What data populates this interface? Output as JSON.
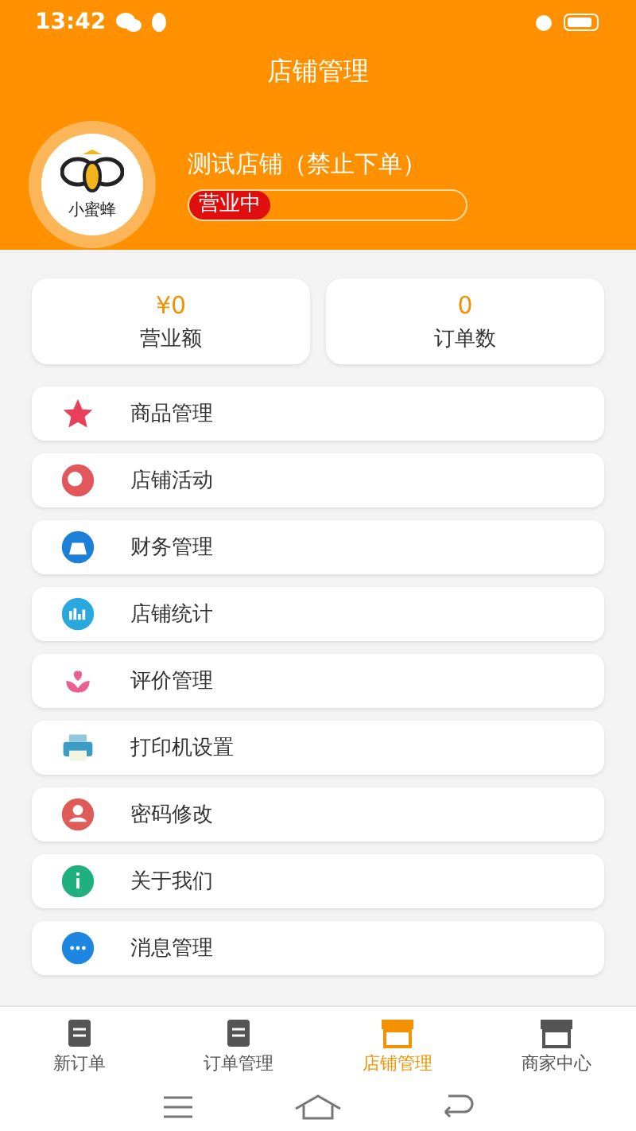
{
  "status_bar": {
    "time": "13:42"
  },
  "header": {
    "title": "店铺管理"
  },
  "shop": {
    "logo_text": "小蜜蜂",
    "name": "测试店铺（禁止下单）",
    "status": "营业中"
  },
  "stats": [
    {
      "value": "¥0",
      "label": "营业额"
    },
    {
      "value": "0",
      "label": "订单数"
    }
  ],
  "menu": [
    {
      "label": "商品管理",
      "kind": "star",
      "color": "#e8405a"
    },
    {
      "label": "店铺活动",
      "kind": "balloon",
      "color": "#e2575c"
    },
    {
      "label": "财务管理",
      "kind": "bag",
      "color": "#1c7fd8"
    },
    {
      "label": "店铺统计",
      "kind": "chart",
      "color": "#29a8e0"
    },
    {
      "label": "评价管理",
      "kind": "flower",
      "color": "#ea5f8f"
    },
    {
      "label": "打印机设置",
      "kind": "printer",
      "color": "#3b9cc4"
    },
    {
      "label": "密码修改",
      "kind": "user",
      "color": "#df5b55"
    },
    {
      "label": "关于我们",
      "kind": "info",
      "color": "#1fb07e"
    },
    {
      "label": "消息管理",
      "kind": "chat",
      "color": "#1c86e0"
    }
  ],
  "tabs": [
    {
      "label": "新订单",
      "kind": "clipboard",
      "selected": false
    },
    {
      "label": "订单管理",
      "kind": "list",
      "selected": false
    },
    {
      "label": "店铺管理",
      "kind": "store",
      "selected": true
    },
    {
      "label": "商家中心",
      "kind": "shop",
      "selected": false
    }
  ]
}
